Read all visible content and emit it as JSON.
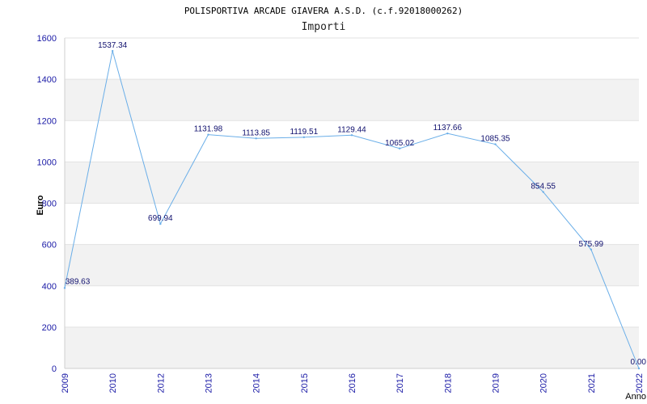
{
  "chart_data": {
    "type": "line",
    "title": "POLISPORTIVA ARCADE GIAVERA A.S.D. (c.f.92018000262)",
    "subtitle": "Importi",
    "xlabel": "Anno",
    "ylabel": "Euro",
    "ylim": [
      0,
      1600
    ],
    "yticks": [
      0,
      200,
      400,
      600,
      800,
      1000,
      1200,
      1400,
      1600
    ],
    "x": [
      "2009",
      "2010",
      "2012",
      "2013",
      "2014",
      "2015",
      "2016",
      "2017",
      "2018",
      "2019",
      "2020",
      "2021",
      "2022"
    ],
    "series": [
      {
        "values": [
          389.63,
          1537.34,
          699.94,
          1131.98,
          1113.85,
          1119.51,
          1129.44,
          1065.02,
          1137.66,
          1085.35,
          854.55,
          575.99,
          0.0
        ],
        "labels": [
          "389.63",
          "1537.34",
          "699.94",
          "1131.98",
          "1113.85",
          "1119.51",
          "1129.44",
          "1065.02",
          "1137.66",
          "1085.35",
          "854.55",
          "575.99",
          "0.00"
        ]
      }
    ],
    "grid": true,
    "band_color": "#f2f2f2",
    "line_color": "#6aaee8",
    "text_color": "#1a1aa6"
  }
}
